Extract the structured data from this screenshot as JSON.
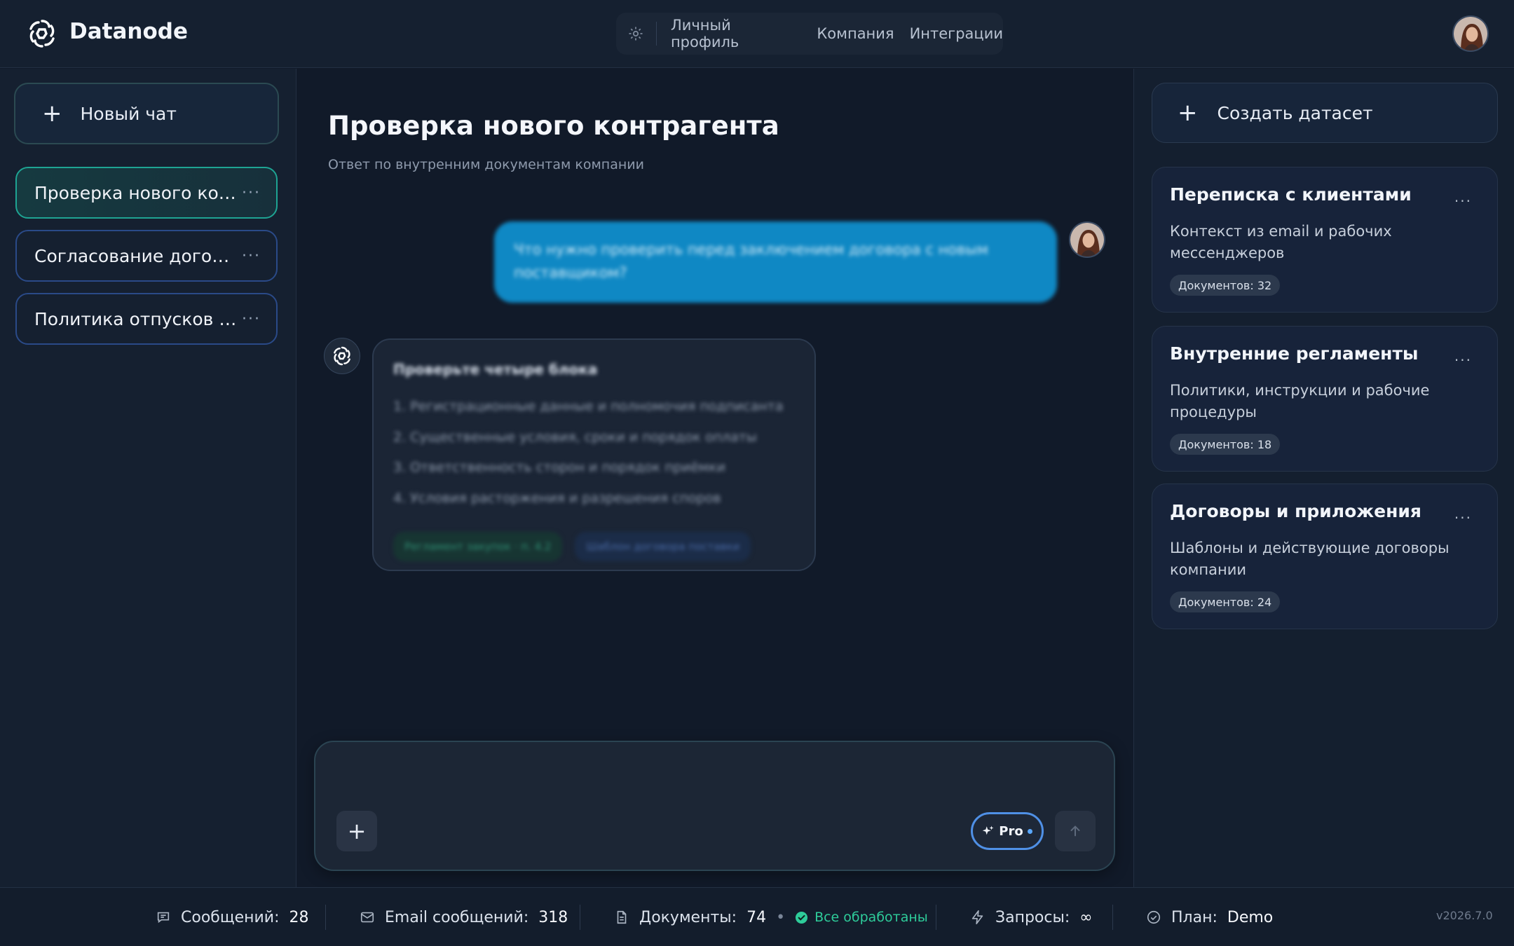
{
  "app": {
    "brand": "Datanode"
  },
  "topnav": {
    "items": [
      "Личный профиль",
      "Компания",
      "Интеграции"
    ]
  },
  "sidebar": {
    "new_chat_label": "Новый чат",
    "chats": [
      {
        "title": "Проверка нового контрагента",
        "active": true
      },
      {
        "title": "Согласование договора",
        "active": false
      },
      {
        "title": "Политика отпусков и больничных",
        "active": false
      }
    ]
  },
  "chat": {
    "title": "Проверка нового контрагента",
    "subtitle": "Ответ по внутренним документам компании",
    "user_message": "Что нужно проверить перед заключением договора с новым поставщиком?",
    "bot_heading": "Проверьте четыре блока",
    "bot_lines": [
      "1. Регистрационные данные и полномочия подписанта",
      "2. Существенные условия, сроки и порядок оплаты",
      "3. Ответственность сторон и порядок приёмки",
      "4. Условия расторжения и разрешения споров"
    ],
    "bot_chips": [
      "Регламент закупок · п. 4.2",
      "Шаблон договора поставки"
    ]
  },
  "composer": {
    "pro_label": "Pro"
  },
  "datasets": {
    "create_label": "Создать датасет",
    "items": [
      {
        "title": "Переписка с клиентами",
        "desc": "Контекст из email и рабочих мессенджеров",
        "badge": "Документов: 32"
      },
      {
        "title": "Внутренние регламенты",
        "desc": "Политики, инструкции и рабочие процедуры",
        "badge": "Документов: 18"
      },
      {
        "title": "Договоры и приложения",
        "desc": "Шаблоны и действующие договоры компании",
        "badge": "Документов: 24"
      }
    ]
  },
  "footer": {
    "messages_label": "Сообщений:",
    "messages_value": "28",
    "email_label": "Email сообщений:",
    "email_value": "318",
    "docs_label": "Документы:",
    "docs_value": "74",
    "docs_status": "Все обработаны",
    "requests_label": "Запросы:",
    "requests_value": "∞",
    "plan_label": "План:",
    "plan_value": "Demo",
    "version": "v2026.7.0"
  },
  "colors": {
    "accent_teal": "#1ea493",
    "user_bubble": "#0f88c4",
    "status_ok": "#2ecc9a",
    "pro_border": "#4f90e6"
  },
  "icons": [
    "datanode-logo-icon",
    "gear-icon",
    "plus-icon",
    "more-icon",
    "sparkle-icon",
    "arrow-up-icon",
    "chat-icon",
    "mail-icon",
    "document-icon",
    "check-circle-icon",
    "bolt-icon",
    "check-icon"
  ]
}
